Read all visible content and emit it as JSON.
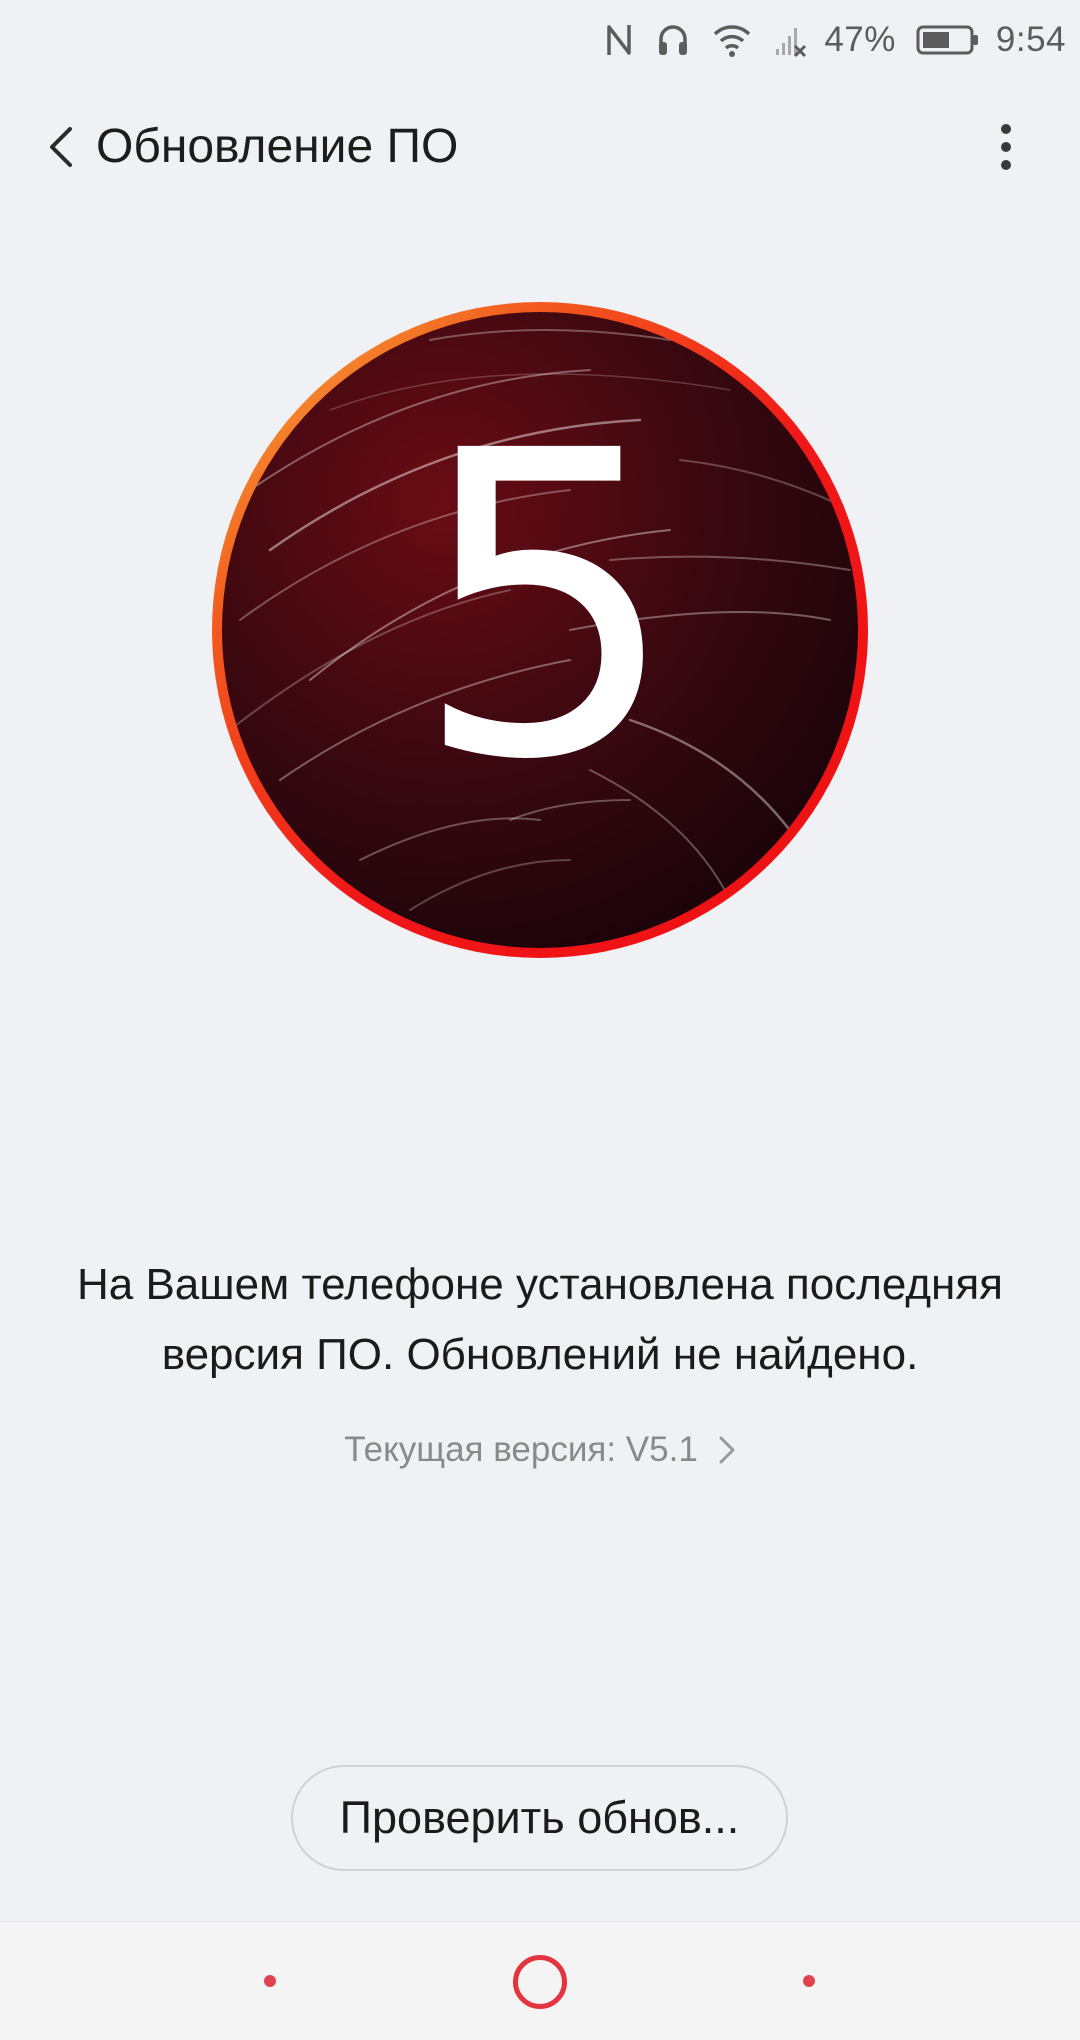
{
  "status_bar": {
    "battery_percent": "47%",
    "time": "9:54",
    "icons": [
      "nfc-icon",
      "headset-icon",
      "wifi-icon",
      "signal-no-sim-icon",
      "battery-icon"
    ]
  },
  "app_bar": {
    "title": "Обновление ПО",
    "back_icon": "chevron-left-icon",
    "menu_icon": "more-vertical-icon"
  },
  "hero": {
    "number": "5",
    "accent_colors": [
      "#f3a233",
      "#f21d1d"
    ],
    "background": "#1b060b"
  },
  "message": {
    "line1": "На Вашем телефоне установлена последняя",
    "line2": "версия ПО. Обновлений не найдено."
  },
  "version": {
    "label": "Текущая версия: V5.1"
  },
  "check_button": {
    "label": "Проверить обнов..."
  },
  "nav_bar": {
    "accent": "#e4343f"
  }
}
